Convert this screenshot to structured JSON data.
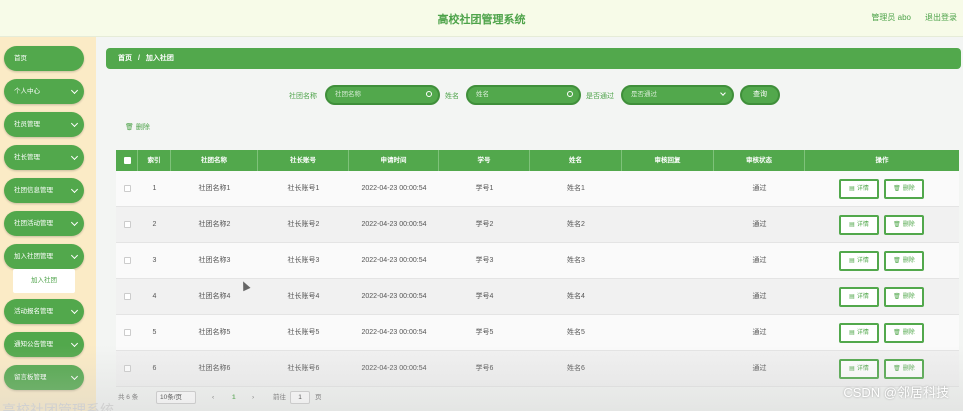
{
  "header": {
    "title": "高校社团管理系统",
    "admin_label": "管理员 abo",
    "logout_label": "退出登录"
  },
  "sidebar": {
    "items": [
      {
        "label": "首页",
        "has_chevron": false
      },
      {
        "label": "个人中心",
        "has_chevron": true
      },
      {
        "label": "社员管理",
        "has_chevron": true
      },
      {
        "label": "社长管理",
        "has_chevron": true
      },
      {
        "label": "社团信息管理",
        "has_chevron": true
      },
      {
        "label": "社团活动管理",
        "has_chevron": true
      },
      {
        "label": "加入社团管理",
        "has_chevron": true
      },
      {
        "label": "活动报名管理",
        "has_chevron": true
      },
      {
        "label": "通知公告管理",
        "has_chevron": true
      },
      {
        "label": "留言板管理",
        "has_chevron": true
      }
    ],
    "active_submenu": "加入社团"
  },
  "breadcrumb": {
    "home": "首页",
    "separator": "/",
    "current": "加入社团"
  },
  "search": {
    "club_label": "社团名称",
    "club_placeholder": "社团名称",
    "name_label": "姓名",
    "name_placeholder": "姓名",
    "approved_label": "是否通过",
    "approved_placeholder": "是否通过",
    "query_label": "查询"
  },
  "toolbar": {
    "delete_label": "删除"
  },
  "table": {
    "headers": [
      "索引",
      "社团名称",
      "社长账号",
      "申请时间",
      "学号",
      "姓名",
      "审核回复",
      "审核状态",
      "操作"
    ],
    "rows": [
      {
        "index": "1",
        "club": "社团名称1",
        "leader": "社长账号1",
        "time": "2022-04-23 00:00:54",
        "sid": "学号1",
        "name": "姓名1",
        "reply": "",
        "status": "通过"
      },
      {
        "index": "2",
        "club": "社团名称2",
        "leader": "社长账号2",
        "time": "2022-04-23 00:00:54",
        "sid": "学号2",
        "name": "姓名2",
        "reply": "",
        "status": "通过"
      },
      {
        "index": "3",
        "club": "社团名称3",
        "leader": "社长账号3",
        "time": "2022-04-23 00:00:54",
        "sid": "学号3",
        "name": "姓名3",
        "reply": "",
        "status": "通过"
      },
      {
        "index": "4",
        "club": "社团名称4",
        "leader": "社长账号4",
        "time": "2022-04-23 00:00:54",
        "sid": "学号4",
        "name": "姓名4",
        "reply": "",
        "status": "通过"
      },
      {
        "index": "5",
        "club": "社团名称5",
        "leader": "社长账号5",
        "time": "2022-04-23 00:00:54",
        "sid": "学号5",
        "name": "姓名5",
        "reply": "",
        "status": "通过"
      },
      {
        "index": "6",
        "club": "社团名称6",
        "leader": "社长账号6",
        "time": "2022-04-23 00:00:54",
        "sid": "学号6",
        "name": "姓名6",
        "reply": "",
        "status": "通过"
      }
    ],
    "detail_label": "详情",
    "delete_label": "删除"
  },
  "pager": {
    "total": "共 6 条",
    "page_size": "10条/页",
    "prev": "‹",
    "current_page": "1",
    "next": "›",
    "goto": "前往",
    "goto_value": "1",
    "page_unit": "页"
  },
  "watermark": "CSDN @邻居科技",
  "bottom_ghost": "高校社团管理系统",
  "colors": {
    "accent": "#52a84c",
    "sidebar_bg": "#fbebc6",
    "header_bg": "#f7fbe8"
  },
  "icons": {
    "search": "search-icon",
    "dropdown": "chevron-down-icon",
    "delete": "trash-icon",
    "detail": "document-icon"
  }
}
